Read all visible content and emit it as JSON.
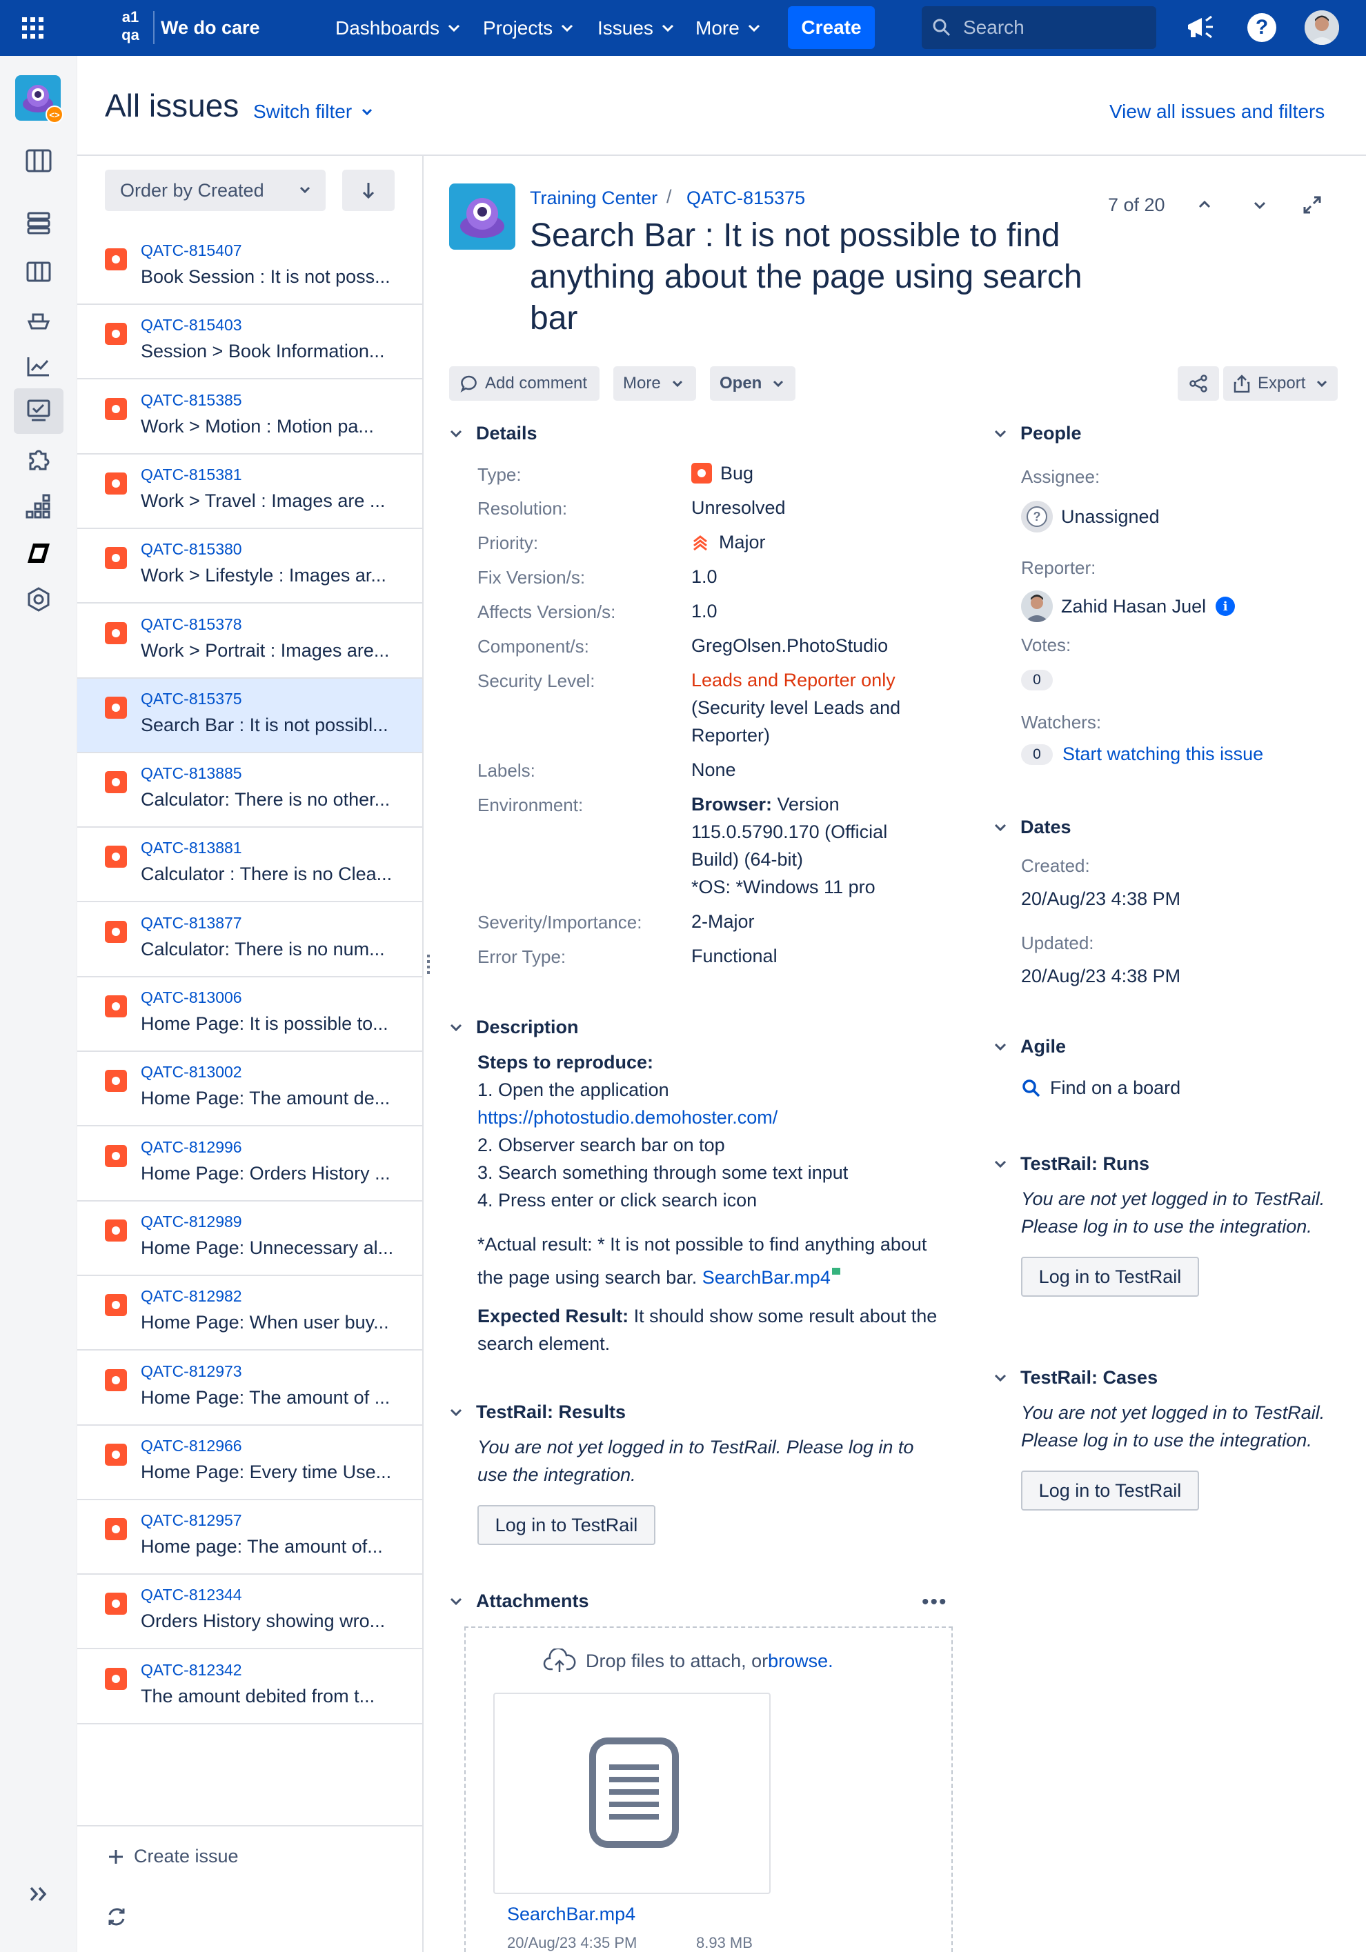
{
  "topbar": {
    "brand": "We do care",
    "nav": [
      "Dashboards",
      "Projects",
      "Issues",
      "More"
    ],
    "create_label": "Create",
    "search_placeholder": "Search"
  },
  "header": {
    "title": "All issues",
    "switch_filter": "Switch filter",
    "view_all": "View all issues and filters"
  },
  "list_controls": {
    "order_label": "Order by Created"
  },
  "issues": [
    {
      "key": "QATC-815407",
      "summary": "Book Session : It is not poss..."
    },
    {
      "key": "QATC-815403",
      "summary": "Session > Book Information..."
    },
    {
      "key": "QATC-815385",
      "summary": "Work > Motion : Motion pa..."
    },
    {
      "key": "QATC-815381",
      "summary": "Work > Travel : Images are ..."
    },
    {
      "key": "QATC-815380",
      "summary": "Work > Lifestyle : Images ar..."
    },
    {
      "key": "QATC-815378",
      "summary": "Work > Portrait : Images are..."
    },
    {
      "key": "QATC-815375",
      "summary": "Search Bar : It is not possibl..."
    },
    {
      "key": "QATC-813885",
      "summary": "Calculator: There is no other..."
    },
    {
      "key": "QATC-813881",
      "summary": "Calculator : There is no Clea..."
    },
    {
      "key": "QATC-813877",
      "summary": "Calculator: There is no num..."
    },
    {
      "key": "QATC-813006",
      "summary": "Home Page: It is possible to..."
    },
    {
      "key": "QATC-813002",
      "summary": "Home Page: The amount de..."
    },
    {
      "key": "QATC-812996",
      "summary": "Home Page: Orders History ..."
    },
    {
      "key": "QATC-812989",
      "summary": "Home Page: Unnecessary al..."
    },
    {
      "key": "QATC-812982",
      "summary": "Home Page: When user buy..."
    },
    {
      "key": "QATC-812973",
      "summary": "Home Page: The amount of ..."
    },
    {
      "key": "QATC-812966",
      "summary": "Home Page: Every time Use..."
    },
    {
      "key": "QATC-812957",
      "summary": "Home page: The amount of..."
    },
    {
      "key": "QATC-812344",
      "summary": "Orders History showing wro..."
    },
    {
      "key": "QATC-812342",
      "summary": "The amount debited from t..."
    }
  ],
  "list_footer": {
    "create_issue": "Create issue"
  },
  "issue": {
    "project": "Training Center",
    "key": "QATC-815375",
    "pager": "7 of 20",
    "title_lines": [
      "Search Bar : It is not possible to find",
      "anything about the page using search",
      "bar"
    ],
    "actions": {
      "add_comment": "Add comment",
      "more": "More",
      "status": "Open",
      "export": "Export"
    },
    "details_heading": "Details",
    "fields": {
      "type_label": "Type:",
      "type": "Bug",
      "resolution_label": "Resolution:",
      "resolution": "Unresolved",
      "priority_label": "Priority:",
      "priority": "Major",
      "fix_label": "Fix Version/s:",
      "fix": "1.0",
      "affects_label": "Affects Version/s:",
      "affects": "1.0",
      "component_label": "Component/s:",
      "component": "GregOlsen.PhotoStudio",
      "security_label": "Security Level:",
      "security": "Leads and Reporter only",
      "security_note_1": "(Security level Leads and",
      "security_note_2": "Reporter)",
      "labels_label": "Labels:",
      "labels": "None",
      "env_label": "Environment:",
      "env_browser_b": "Browser:",
      "env_l1": " Version",
      "env_l2": "115.0.5790.170 (Official",
      "env_l3": "Build) (64-bit)",
      "env_l4": "*OS: *Windows 11 pro",
      "severity_label": "Severity/Importance:",
      "severity": "2-Major",
      "error_label": "Error Type:",
      "error": "Functional"
    },
    "description": {
      "heading": "Description",
      "steps_heading": "Steps to reproduce:",
      "step1": "1. Open the application",
      "url": "https://photostudio.demohoster.com/",
      "step2": "2. Observer search bar on top",
      "step3": "3. Search something through some text input",
      "step4": "4. Press enter or click search icon",
      "actual_1": "*Actual result: * It is not possible to find anything about",
      "actual_2": "the page using search bar. ",
      "actual_link": "SearchBar.mp4",
      "expected_b": "Expected Result:",
      "expected_1": " It should show some result about the",
      "expected_2": "search element."
    },
    "testrail_results": {
      "heading": "TestRail: Results",
      "msg_1": "You are not yet logged in to TestRail. Please log in to",
      "msg_2": "use the integration.",
      "button": "Log in to TestRail"
    },
    "attachments": {
      "heading": "Attachments",
      "drop_text": "Drop files to attach, or ",
      "browse": "browse.",
      "file_name": "SearchBar.mp4",
      "file_date": "20/Aug/23 4:35 PM",
      "file_size": "8.93 MB"
    }
  },
  "sidebar": {
    "people_heading": "People",
    "assignee_label": "Assignee:",
    "assignee": "Unassigned",
    "reporter_label": "Reporter:",
    "reporter": "Zahid Hasan Juel",
    "votes_label": "Votes:",
    "votes": "0",
    "watchers_label": "Watchers:",
    "watchers": "0",
    "watch_link": "Start watching this issue",
    "dates_heading": "Dates",
    "created_label": "Created:",
    "created": "20/Aug/23 4:38 PM",
    "updated_label": "Updated:",
    "updated": "20/Aug/23 4:38 PM",
    "agile_heading": "Agile",
    "agile_link": "Find on a board",
    "runs_heading": "TestRail: Runs",
    "runs_msg_1": "You are not yet logged in to TestRail.",
    "runs_msg_2": "Please log in to use the integration.",
    "runs_button": "Log in to TestRail",
    "cases_heading": "TestRail: Cases",
    "cases_msg_1": "You are not yet logged in to TestRail.",
    "cases_msg_2": "Please log in to use the integration.",
    "cases_button": "Log in to TestRail"
  },
  "colors": {
    "brand": "#0747a6",
    "accent": "#0065ff",
    "bug": "#ff5630",
    "security": "#de350b",
    "selected": "#deebff"
  }
}
